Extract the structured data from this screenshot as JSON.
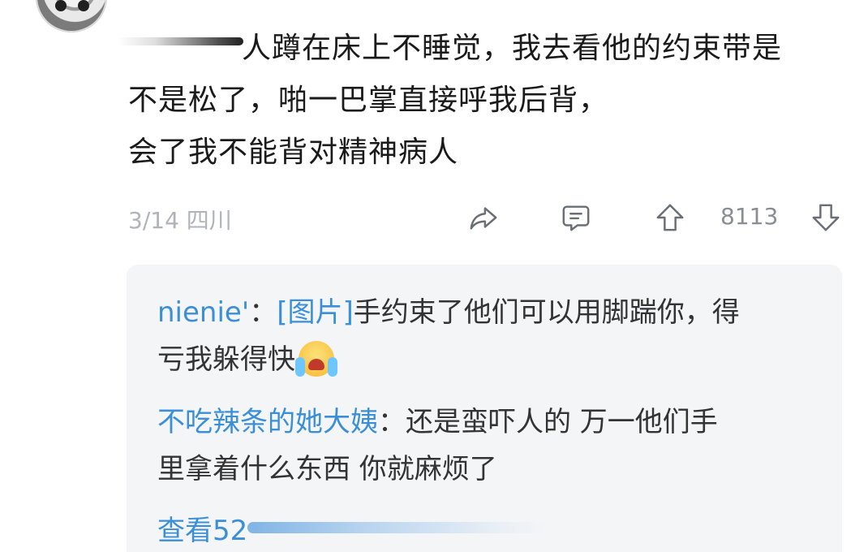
{
  "comment": {
    "lines": [
      "人蹲在床上不睡觉，我去看他的约束带是",
      "不是松了，啪一巴掌直接呼我后背，",
      "会了我不能背对精神病人"
    ],
    "date": "3/14",
    "location": "四川",
    "vote_count": "8113"
  },
  "icons": {
    "share": "share-icon",
    "reply": "comment-icon",
    "upvote": "arrow-up-icon",
    "downvote": "arrow-down-icon",
    "emoji": "crying-face-emoji-icon"
  },
  "replies": [
    {
      "user": "nienie'",
      "separator": "：",
      "tag": "[图片]",
      "text": "手约束了他们可以用脚踹你，得",
      "text2": "亏我躲得快"
    },
    {
      "user": "不吃辣条的她大姨",
      "separator": "：",
      "text": "还是蛮吓人的 万一他们手",
      "text2": "里拿着什么东西 你就麻烦了"
    }
  ],
  "view_more": {
    "label": "查看52"
  },
  "colors": {
    "link": "#3b8fd8",
    "meta": "#b0b3b8",
    "panel": "#f4f5f7",
    "text": "#1a1a1a"
  }
}
